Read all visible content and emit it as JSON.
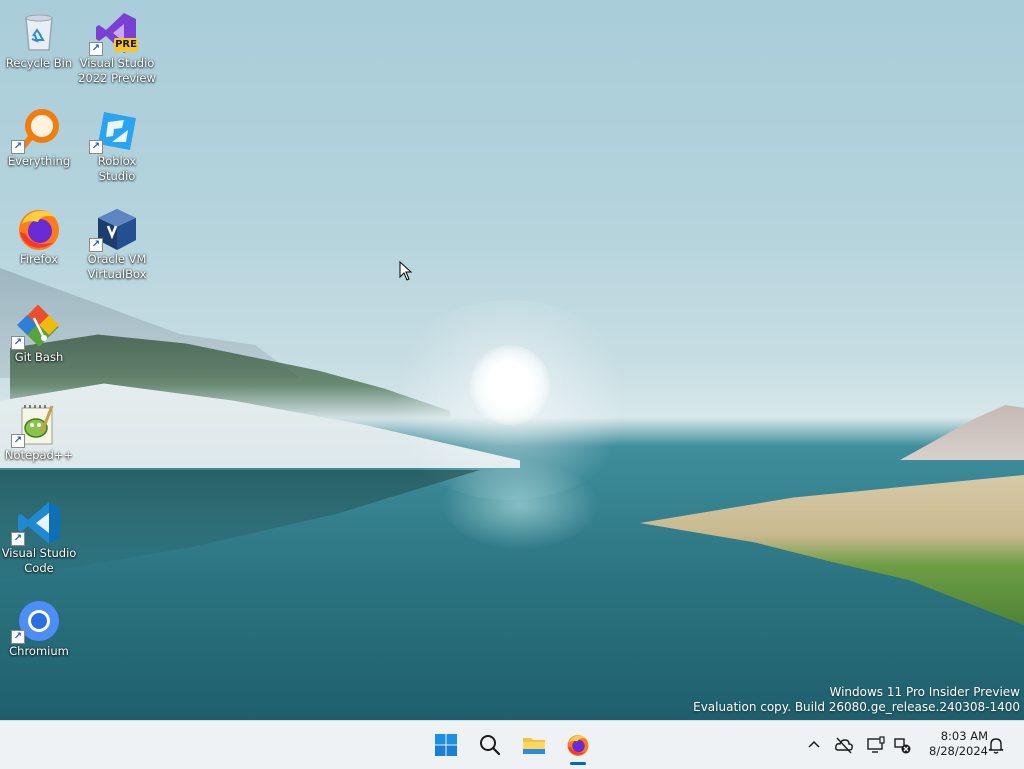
{
  "desktop_icons": [
    {
      "id": "recycle-bin",
      "label": "Recycle Bin",
      "icon": "recycle-bin-icon",
      "shortcut": false
    },
    {
      "id": "visual-studio-2022-preview",
      "label": "Visual Studio 2022 Preview",
      "icon": "visual-studio-preview-icon",
      "badge": "PRE",
      "shortcut": true
    },
    {
      "id": "everything",
      "label": "Everything",
      "icon": "everything-search-icon",
      "shortcut": true
    },
    {
      "id": "roblox-studio",
      "label": "Roblox Studio",
      "icon": "roblox-studio-icon",
      "shortcut": true
    },
    {
      "id": "firefox",
      "label": "Firefox",
      "icon": "firefox-icon",
      "shortcut": true
    },
    {
      "id": "oracle-vm-virtualbox",
      "label": "Oracle VM VirtualBox",
      "icon": "virtualbox-icon",
      "shortcut": true
    },
    {
      "id": "git-bash",
      "label": "Git Bash",
      "icon": "git-bash-icon",
      "shortcut": true
    },
    {
      "id": "notepad-plus-plus",
      "label": "Notepad++",
      "icon": "notepad-plus-plus-icon",
      "shortcut": true
    },
    {
      "id": "visual-studio-code",
      "label": "Visual Studio Code",
      "icon": "vscode-icon",
      "shortcut": true
    },
    {
      "id": "chromium",
      "label": "Chromium",
      "icon": "chromium-icon",
      "shortcut": true
    }
  ],
  "watermark": {
    "line1": "Windows 11 Pro Insider Preview",
    "line2": "Evaluation copy. Build 26080.ge_release.240308-1400"
  },
  "taskbar": {
    "pinned": [
      {
        "id": "start",
        "icon": "windows-start-icon"
      },
      {
        "id": "search",
        "icon": "search-icon"
      },
      {
        "id": "file-explorer",
        "icon": "file-explorer-icon"
      },
      {
        "id": "firefox",
        "icon": "firefox-icon",
        "running": true
      }
    ],
    "tray": [
      {
        "id": "show-hidden",
        "icon": "chevron-up-icon"
      },
      {
        "id": "onedrive",
        "icon": "onedrive-offline-icon"
      },
      {
        "id": "display",
        "icon": "display-icon"
      },
      {
        "id": "network",
        "icon": "network-disconnected-icon"
      }
    ],
    "clock": {
      "time": "8:03 AM",
      "date": "8/28/2024"
    },
    "notifications_icon": "bell-icon"
  },
  "colors": {
    "taskbar_bg": "#eef2f5",
    "accent": "#0067c0",
    "label_text": "#ffffff"
  }
}
